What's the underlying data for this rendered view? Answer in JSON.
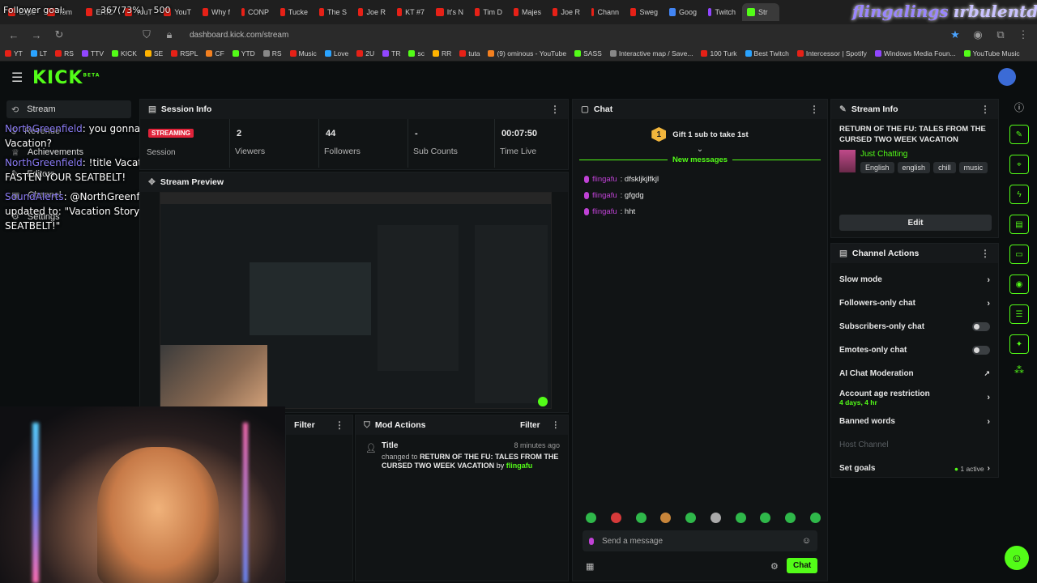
{
  "browser": {
    "overlay_goal": "Follower goal:",
    "overlay_goal_count": "367(73%)",
    "overlay_goal_500": "500",
    "tabs": [
      "Expe",
      "Tom",
      "ERIC",
      "YouT",
      "YouT",
      "Why f",
      "CONP",
      "Tucke",
      "The S",
      "Joe R",
      "KT #7",
      "It's N",
      "Tim D",
      "Majes",
      "Joe R",
      "Chann",
      "Sweg",
      "Goog",
      "Twitch",
      "Str"
    ],
    "brand_overlay": "flingalings",
    "brand_overlay_2": "ırbulentdiven",
    "url": "dashboard.kick.com/stream",
    "bookmarks": [
      "YT",
      "LT",
      "RS",
      "TTV",
      "KICK",
      "SE",
      "RSPL",
      "CF",
      "YTD",
      "RS",
      "Music",
      "Love",
      "2U",
      "TR",
      "sc",
      "RR",
      "tuta",
      "(9) ominous - YouTube",
      "SASS",
      "Interactive map / Save...",
      "100 Turk",
      "Best Twitch",
      "Intercessor | Spotify",
      "Windows Media Foun...",
      "YouTube Music"
    ]
  },
  "kick": {
    "logo": "KICK",
    "beta": "BETA"
  },
  "sidebar": {
    "items": [
      {
        "label": "Stream",
        "icon": "stream-icon"
      },
      {
        "label": "Revenue",
        "icon": "revenue-icon"
      },
      {
        "label": "Achievements",
        "icon": "trophy-icon"
      },
      {
        "label": "Editors",
        "icon": "editors-icon"
      },
      {
        "label": "Channel",
        "icon": "channel-icon"
      },
      {
        "label": "Settings",
        "icon": "gear-icon"
      }
    ]
  },
  "overlay_chat": {
    "line1_user": "NorthGreenfield",
    "line1_text": ": you gonna talk about your Vacation?",
    "line2_user": "NorthGreenfield",
    "line2_text": ": !title Vacation Story time",
    "line2_text_b": "FASTEN YOUR SEATBELT!",
    "line3_user": "SoundAlerts",
    "line3_text": ": @NorthGreenfield Channel title updated to: \"Vacation Story time",
    "line3_text_b": "FASTEN YOUR SEATBELT!\""
  },
  "session": {
    "title": "Session Info",
    "badge": "STREAMING",
    "session_label": "Session",
    "stats": [
      {
        "value": "2",
        "label": "Viewers"
      },
      {
        "value": "44",
        "label": "Followers"
      },
      {
        "value": "-",
        "label": "Sub Counts"
      },
      {
        "value": "00:07:50",
        "label": "Time Live"
      }
    ]
  },
  "preview": {
    "title": "Stream Preview"
  },
  "filter_left": {
    "label": "Filter"
  },
  "mod_actions": {
    "title": "Mod Actions",
    "filter": "Filter",
    "entry_title": "Title",
    "entry_time": "8 minutes ago",
    "entry_prefix": "changed to",
    "entry_value": "RETURN OF THE FU: TALES FROM THE CURSED TWO WEEK VACATION",
    "entry_by": "by",
    "entry_user": "flingafu"
  },
  "chat": {
    "title": "Chat",
    "gift_count": "1",
    "gift_text": "Gift 1 sub to take 1st",
    "new_messages": "New messages",
    "messages": [
      {
        "user": "flingafu",
        "text": ": dfsklјkjlfkjl"
      },
      {
        "user": "flingafu",
        "text": ": gfgdg"
      },
      {
        "user": "flingafu",
        "text": ": hht"
      }
    ],
    "placeholder": "Send a message",
    "send": "Chat"
  },
  "stream_info": {
    "title": "Stream Info",
    "stream_title": "RETURN OF THE FU: TALES FROM THE CURSED TWO WEEK VACATION",
    "category": "Just Chatting",
    "tags": [
      "English",
      "english",
      "chill",
      "music"
    ],
    "edit": "Edit"
  },
  "channel_actions": {
    "title": "Channel Actions",
    "slow_mode": "Slow mode",
    "followers_only": "Followers-only chat",
    "subscribers_only": "Subscribers-only chat",
    "emotes_only": "Emotes-only chat",
    "ai_moderation": "AI Chat Moderation",
    "age_restriction": "Account age restriction",
    "age_value": "4 days, 4 hr",
    "banned_words": "Banned words",
    "host_channel": "Host Channel",
    "set_goals": "Set goals",
    "goals_active": "1 active"
  },
  "colors": {
    "accent": "#53fc18",
    "background": "#0b0e0f",
    "panel": "#111415"
  }
}
